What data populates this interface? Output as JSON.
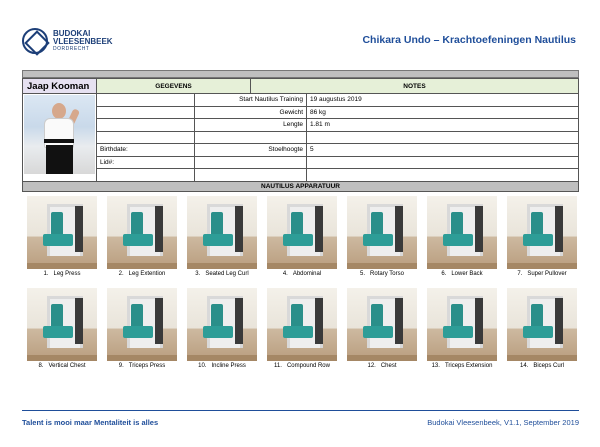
{
  "logo": {
    "line1": "BUDOKAI",
    "line2": "VLEESENBEEK",
    "line3": "DORDRECHT"
  },
  "document_title": "Chikara Undo – Krachtoefeningen Nautilus",
  "member": {
    "name": "Jaap Kooman",
    "col_gegevens": "GEGEVENS",
    "col_notes": "NOTES",
    "birthdate_label": "Birthdate:",
    "lid_label": "Lid#:",
    "fields": [
      {
        "label": "Start Nautilus Training",
        "value": "19 augustus 2019"
      },
      {
        "label": "Gewicht",
        "value": "86 kg"
      },
      {
        "label": "Lengte",
        "value": "1.81 m"
      },
      {
        "label": "Stoelhoogte",
        "value": "5"
      }
    ]
  },
  "section_title": "NAUTILUS APPARATUUR",
  "machines": [
    {
      "num": "1.",
      "name": "Leg Press"
    },
    {
      "num": "2.",
      "name": "Leg Extention"
    },
    {
      "num": "3.",
      "name": "Seated Leg Curl"
    },
    {
      "num": "4.",
      "name": "Abdominal"
    },
    {
      "num": "5.",
      "name": "Rotary Torso"
    },
    {
      "num": "6.",
      "name": "Lower Back"
    },
    {
      "num": "7.",
      "name": "Super Pullover"
    },
    {
      "num": "8.",
      "name": "Vertical Chest"
    },
    {
      "num": "9.",
      "name": "Triceps Press"
    },
    {
      "num": "10.",
      "name": "Incline Press"
    },
    {
      "num": "11.",
      "name": "Compound Row"
    },
    {
      "num": "12.",
      "name": "Chest"
    },
    {
      "num": "13.",
      "name": "Triceps Extension"
    },
    {
      "num": "14.",
      "name": "Biceps Curl"
    }
  ],
  "footer": {
    "slogan": "Talent is mooi maar Mentaliteit is alles",
    "version": "Budokai Vleesenbeek, V1.1, September 2019"
  },
  "colors": {
    "title_blue": "#1f4e9a",
    "seat_teal": "#2d9d97",
    "header_green": "#e6f0d8",
    "name_lavender": "#e6e1f1"
  }
}
